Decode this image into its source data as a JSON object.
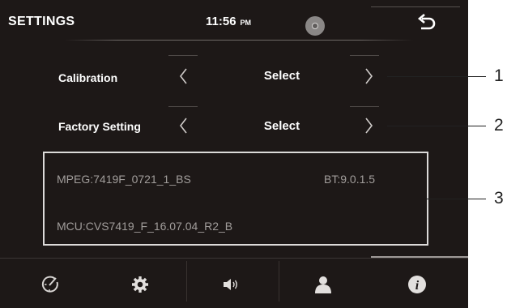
{
  "header": {
    "title": "SETTINGS",
    "time": "11:56",
    "ampm": "PM"
  },
  "rows": [
    {
      "label": "Calibration",
      "value": "Select"
    },
    {
      "label": "Factory Setting",
      "value": "Select"
    }
  ],
  "info": {
    "mpeg": "MPEG:7419F_0721_1_BS",
    "bt": "BT:9.0.1.5",
    "mcu": "MCU:CVS7419_F_16.07.04_R2_B"
  },
  "bottom_tabs": [
    "clock-gauge-icon",
    "gear-icon",
    "speaker-icon",
    "user-icon",
    "info-icon"
  ],
  "callouts": [
    "1",
    "2",
    "3"
  ]
}
